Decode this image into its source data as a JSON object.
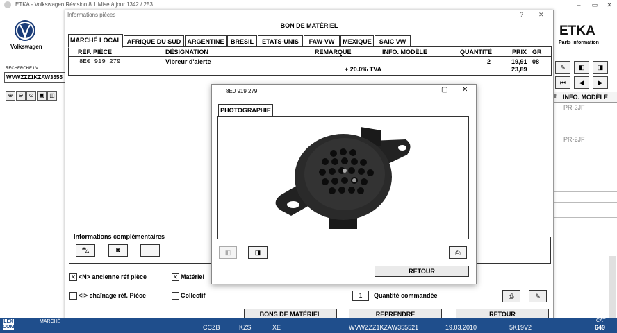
{
  "app": {
    "title": "ETKA - Volkswagen Révision 8.1 Mise à jour 1342 / 253",
    "brand": "Volkswagen",
    "logo_text": "ETKA",
    "logo_sub": "Parts Information",
    "search_label": "RECHERCHE I.V.",
    "search_value": "WVWZZZ1KZAW3555"
  },
  "right_panel": {
    "col_header_partial": "E",
    "col_header": "INFO. MODÈLE",
    "rows": [
      "PR-2JF",
      "PR-2JF"
    ]
  },
  "dialog1": {
    "title": "Informations pièces",
    "help": "?",
    "close": "✕",
    "header": "BON DE MATÉRIEL",
    "tabs": [
      "MARCHÉ LOCAL",
      "AFRIQUE DU SUD",
      "ARGENTINE",
      "BRESIL",
      "ETATS-UNIS",
      "FAW-VW",
      "MEXIQUE",
      "SAIC VW"
    ],
    "columns": {
      "ref": "RÉF. PIÈCE",
      "designation": "DÉSIGNATION",
      "remarque": "REMARQUE",
      "info_modele": "INFO. MODÈLE",
      "quantite": "QUANTITÉ",
      "prix": "PRIX",
      "gr": "GR"
    },
    "row": {
      "ref": "8E0 919 279",
      "designation": "Vibreur d'alerte",
      "quantite": "2",
      "prix": "19,91",
      "gr": "08",
      "tva_label": "+ 20.0% TVA",
      "prix_tva": "23,89"
    },
    "info_comp": "Informations complémentaires",
    "options": {
      "ancienne": "<N> ancienne réf pièce",
      "chainage": "<I> chaînage réf. Pièce",
      "materiel": "Matériel",
      "collectif": "Collectif",
      "ancienne_checked": "✕",
      "materiel_checked": "✕"
    },
    "qty_value": "1",
    "qty_label": "Quantité commandée",
    "buttons": {
      "bons": "BONS DE MATÉRIEL",
      "reprendre": "REPRENDRE",
      "retour": "RETOUR"
    }
  },
  "dialog2": {
    "title": "8E0 919 279",
    "tab": "PHOTOGRAPHIE",
    "retour": "RETOUR"
  },
  "statusbar": {
    "logo": "LEX COM",
    "marche": "MARCHÉ",
    "c1": "CCZB",
    "c2": "KZS",
    "c3": "XE",
    "vin": "WVWZZZ1KZAW355521",
    "date": "19.03.2010",
    "code": "5K19V2",
    "cat_label": "CAT",
    "cat_value": "649"
  },
  "colors": {
    "statusbar": "#1f4e8c",
    "vw_blue": "#1a3c78"
  }
}
